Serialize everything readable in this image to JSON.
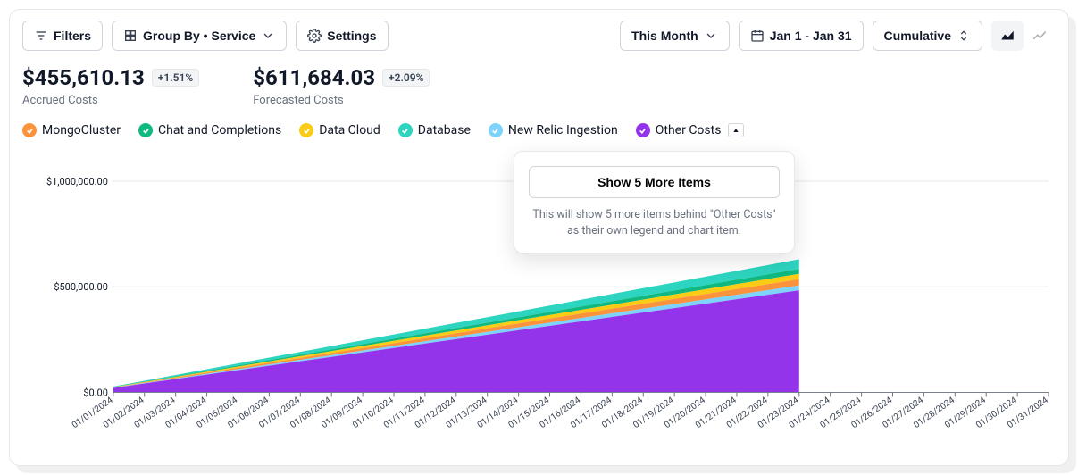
{
  "toolbar": {
    "filters": "Filters",
    "groupby": "Group By • Service",
    "settings": "Settings",
    "period": "This Month",
    "daterange": "Jan 1 - Jan 31",
    "cumulative": "Cumulative"
  },
  "stats": {
    "accrued": {
      "value": "$455,610.13",
      "delta": "+1.51%",
      "label": "Accrued Costs"
    },
    "forecast": {
      "value": "$611,684.03",
      "delta": "+2.09%",
      "label": "Forecasted Costs"
    }
  },
  "legend": [
    {
      "label": "MongoCluster",
      "color": "#fb923c"
    },
    {
      "label": "Chat and Completions",
      "color": "#10b981"
    },
    {
      "label": "Data Cloud",
      "color": "#facc15"
    },
    {
      "label": "Database",
      "color": "#2dd4bf"
    },
    {
      "label": "New Relic Ingestion",
      "color": "#7dd3fc"
    },
    {
      "label": "Other Costs",
      "color": "#9333ea"
    }
  ],
  "popover": {
    "button": "Show 5 More Items",
    "hint": "This will show 5 more items behind \"Other Costs\" as their own legend and chart item."
  },
  "chart_data": {
    "type": "area",
    "title": "",
    "xlabel": "",
    "ylabel": "",
    "ylim": [
      0,
      1000000
    ],
    "yticks": [
      "$0.00",
      "$500,000.00",
      "$1,000,000.00"
    ],
    "categories": [
      "01/01/2024",
      "01/02/2024",
      "01/03/2024",
      "01/04/2024",
      "01/05/2024",
      "01/06/2024",
      "01/07/2024",
      "01/08/2024",
      "01/09/2024",
      "01/10/2024",
      "01/11/2024",
      "01/12/2024",
      "01/13/2024",
      "01/14/2024",
      "01/15/2024",
      "01/16/2024",
      "01/17/2024",
      "01/18/2024",
      "01/19/2024",
      "01/20/2024",
      "01/21/2024",
      "01/22/2024",
      "01/23/2024",
      "01/24/2024",
      "01/25/2024",
      "01/26/2024",
      "01/27/2024",
      "01/28/2024",
      "01/29/2024",
      "01/30/2024",
      "01/31/2024"
    ],
    "observed_days": 23,
    "series": [
      {
        "name": "Other Costs",
        "color": "#9333ea",
        "values": [
          21000,
          42000,
          63000,
          84000,
          105000,
          126000,
          147000,
          168000,
          189000,
          210000,
          231000,
          252000,
          273000,
          294000,
          315000,
          336000,
          357000,
          378000,
          399000,
          420000,
          441000,
          462000,
          483000
        ]
      },
      {
        "name": "New Relic Ingestion",
        "color": "#7dd3fc",
        "values": [
          1000,
          2000,
          3000,
          4000,
          5000,
          6000,
          7000,
          8000,
          9000,
          10000,
          11000,
          12000,
          13000,
          14000,
          15000,
          16000,
          17000,
          18000,
          19000,
          20000,
          21000,
          22000,
          23000
        ]
      },
      {
        "name": "MongoCluster",
        "color": "#fb923c",
        "values": [
          1300,
          2600,
          3900,
          5200,
          6500,
          7800,
          9100,
          10400,
          11700,
          13000,
          14300,
          15600,
          16900,
          18200,
          19500,
          20800,
          22100,
          23400,
          24700,
          26000,
          27300,
          28600,
          29900
        ]
      },
      {
        "name": "Data Cloud",
        "color": "#facc15",
        "values": [
          1100,
          2200,
          3300,
          4400,
          5500,
          6600,
          7700,
          8800,
          9900,
          11000,
          12100,
          13200,
          14300,
          15400,
          16500,
          17600,
          18700,
          19800,
          20900,
          22000,
          23100,
          24200,
          25300
        ]
      },
      {
        "name": "Chat and Completions",
        "color": "#10b981",
        "values": [
          1000,
          2000,
          3000,
          4000,
          5000,
          6000,
          7000,
          8000,
          9000,
          10000,
          11000,
          12000,
          13000,
          14000,
          15000,
          16000,
          17000,
          18000,
          19000,
          20000,
          21000,
          22000,
          23000
        ]
      },
      {
        "name": "Database",
        "color": "#2dd4bf",
        "values": [
          2000,
          4000,
          6000,
          8000,
          10000,
          12000,
          14000,
          16000,
          18000,
          20000,
          22000,
          24000,
          26000,
          28000,
          30000,
          32000,
          34000,
          36000,
          38000,
          40000,
          42000,
          44000,
          46000
        ]
      }
    ]
  }
}
